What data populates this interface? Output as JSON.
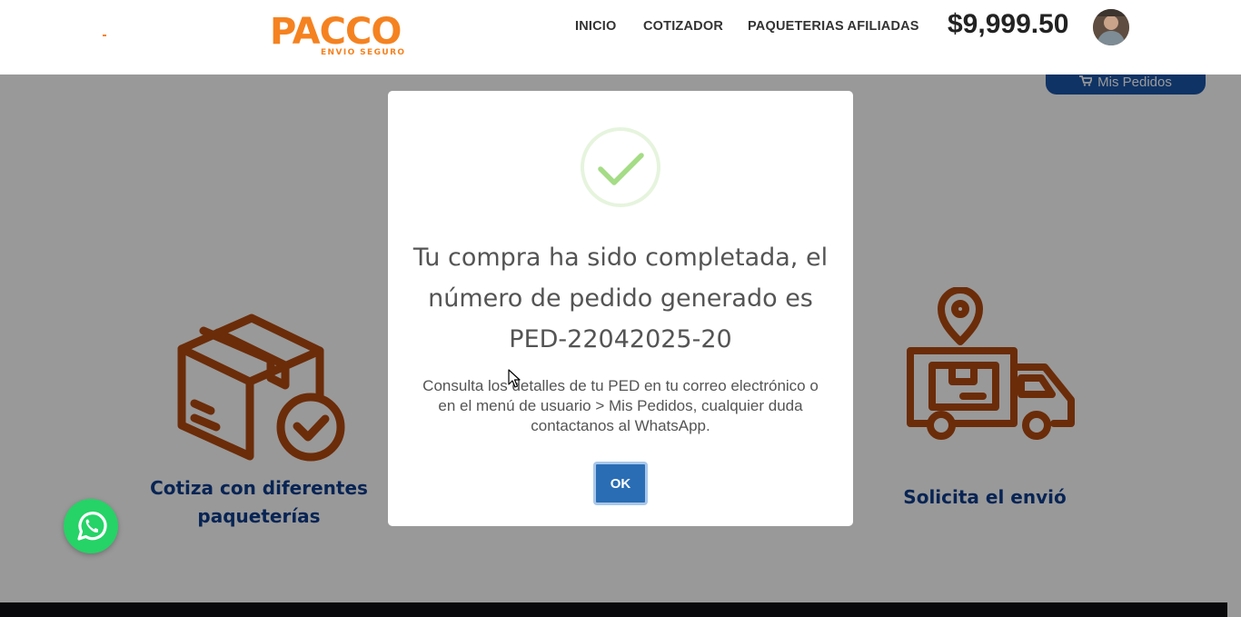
{
  "brand": {
    "logo_text": "PACCO",
    "tagline": "ENVIO SEGURO",
    "accent_color": "#f58220"
  },
  "nav": {
    "items": [
      {
        "label": "INICIO"
      },
      {
        "label": "COTIZADOR"
      },
      {
        "label": "PAQUETERIAS AFILIADAS"
      }
    ],
    "balance": "$9,999.50"
  },
  "page": {
    "mis_pedidos_label": "Mis Pedidos",
    "features": [
      {
        "title": "Cotiza con diferentes paqueterías",
        "icon": "box-check-icon"
      },
      {
        "title": "Solicita el envió",
        "icon": "delivery-truck-icon"
      }
    ],
    "feature_color": "#b34a0f"
  },
  "modal": {
    "icon": "success-check-icon",
    "title": "Tu compra ha sido completada, el número de pedido generado es PED-22042025-20",
    "message": "Consulta los detalles de tu PED en tu correo electrónico o en el menú de usuario > Mis Pedidos, cualquier duda contactanos al WhatsApp.",
    "ok_label": "OK"
  },
  "whatsapp": {
    "icon": "whatsapp-icon",
    "color": "#25d366"
  }
}
